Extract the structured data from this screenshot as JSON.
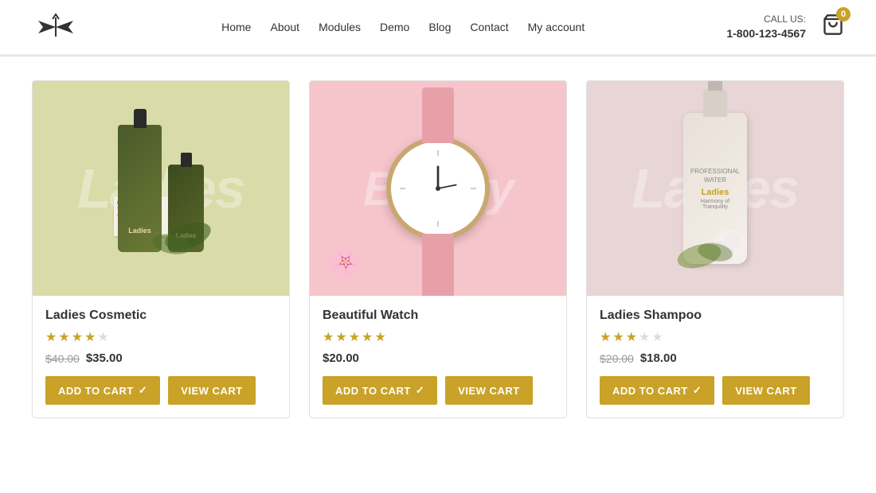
{
  "header": {
    "logo_alt": "Brand Logo",
    "call_label": "CALL US:",
    "phone": "1-800-123-4567",
    "cart_count": "0",
    "nav_items": [
      {
        "label": "Home",
        "href": "#"
      },
      {
        "label": "About",
        "href": "#"
      },
      {
        "label": "Modules",
        "href": "#"
      },
      {
        "label": "Demo",
        "href": "#"
      },
      {
        "label": "Blog",
        "href": "#"
      },
      {
        "label": "Contact",
        "href": "#"
      },
      {
        "label": "My account",
        "href": "#"
      }
    ]
  },
  "products": [
    {
      "id": "cosmetic",
      "name": "Ladies Cosmetic",
      "stars": [
        1,
        1,
        1,
        1,
        0
      ],
      "price_original": "$40.00",
      "price_sale": "$35.00",
      "has_original": true,
      "add_to_cart_label": "ADD TO CART",
      "view_cart_label": "VIEW CART",
      "watermark": "Ladies",
      "bg_class": "cosmetic-bg"
    },
    {
      "id": "watch",
      "name": "Beautiful Watch",
      "stars": [
        1,
        1,
        1,
        1,
        1
      ],
      "price_original": null,
      "price_sale": "$20.00",
      "has_original": false,
      "add_to_cart_label": "ADD TO CART",
      "view_cart_label": "VIEW CART",
      "watermark": "Beauty",
      "bg_class": "watch-bg"
    },
    {
      "id": "shampoo",
      "name": "Ladies Shampoo",
      "stars": [
        1,
        1,
        1,
        0,
        0
      ],
      "price_original": "$20.00",
      "price_sale": "$18.00",
      "has_original": true,
      "add_to_cart_label": "ADD TO CART",
      "view_cart_label": "VIEW CART",
      "watermark": "Ladies",
      "bg_class": "shampoo-bg"
    }
  ]
}
